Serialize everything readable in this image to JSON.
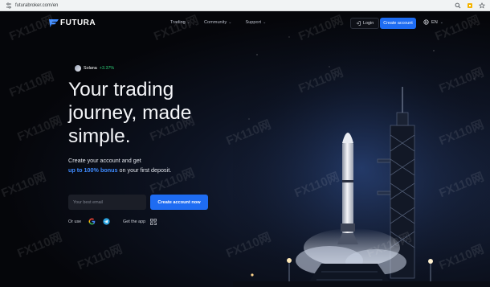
{
  "browser": {
    "url": "futurabroker.com/en"
  },
  "nav": {
    "logo_text": "FUTURA",
    "links": [
      {
        "label": "Trading"
      },
      {
        "label": "Community"
      },
      {
        "label": "Support"
      }
    ],
    "login_label": "Login",
    "create_account_label": "Create account",
    "language": "EN"
  },
  "hero": {
    "ticker": {
      "name": "Solana",
      "change": "+3.37%"
    },
    "headline": "Your trading journey, made simple.",
    "subtitle_line1": "Create your account and get",
    "bonus_text": "up to 100% bonus",
    "subtitle_line2_rest": " on your first deposit.",
    "email_placeholder": "Your best email",
    "cta_label": "Create account now",
    "or_use_label": "Or use",
    "get_app_label": "Get the app"
  },
  "watermark": "FX110网",
  "icons": [
    "tune-icon",
    "search-icon",
    "extension-icon",
    "star-icon",
    "login-icon",
    "globe-icon",
    "chevron-down-icon",
    "google-icon",
    "telegram-icon",
    "qr-code-icon",
    "solana-icon"
  ],
  "colors": {
    "accent": "#1e6cf2",
    "bonus": "#3f8bff",
    "positive": "#2fd07a",
    "background": "#06070c"
  }
}
